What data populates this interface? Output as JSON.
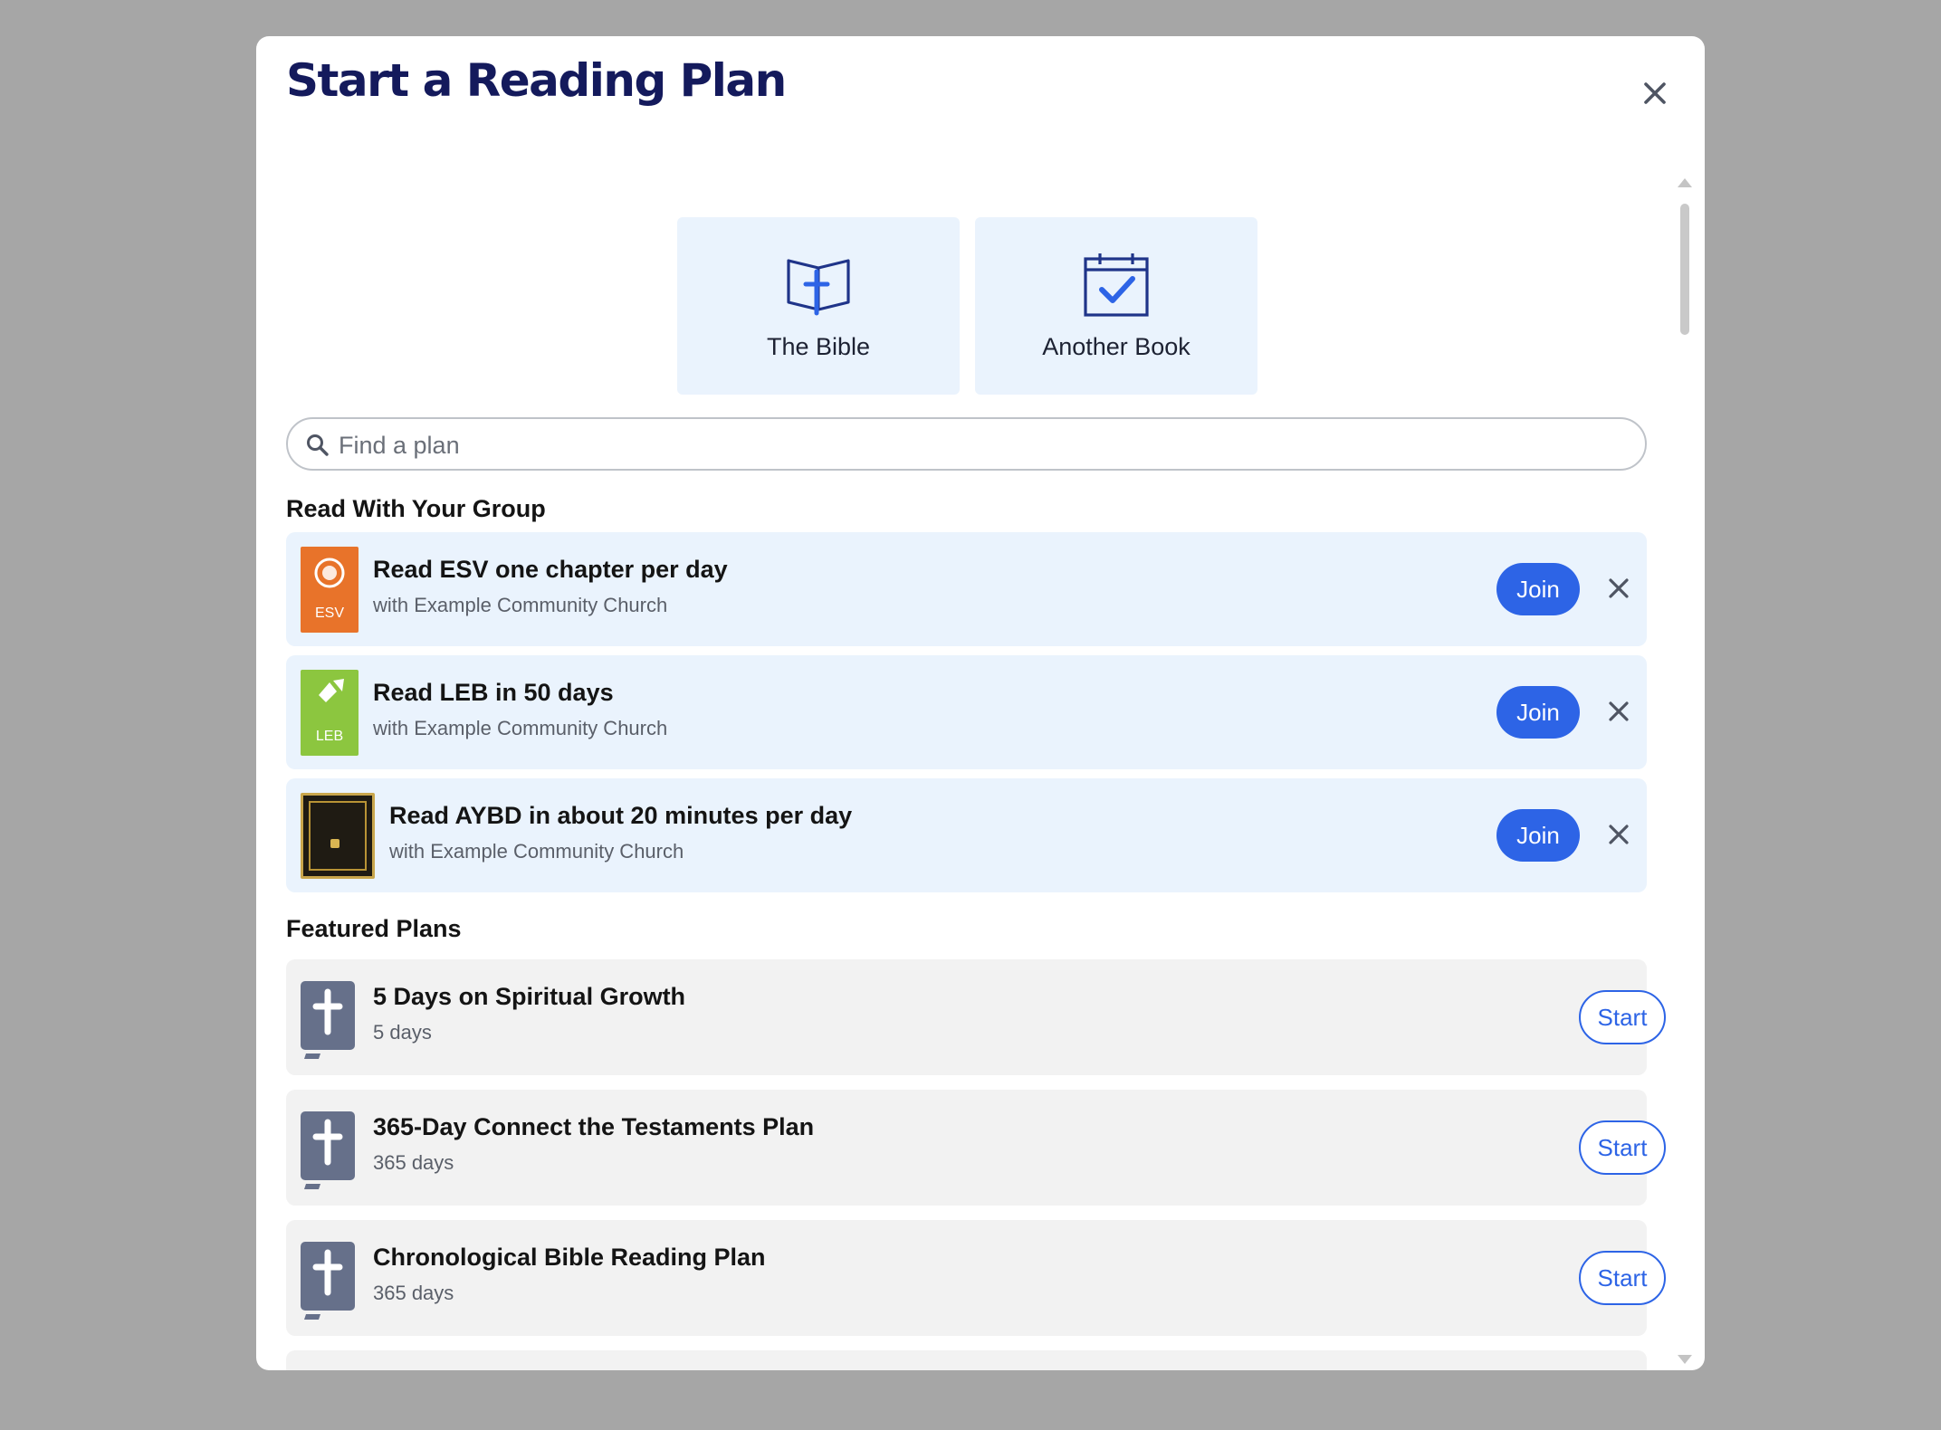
{
  "modal": {
    "title": "Start a Reading Plan",
    "close_icon": "close-icon"
  },
  "choices": [
    {
      "label": "The Bible",
      "icon": "bible-icon"
    },
    {
      "label": "Another Book",
      "icon": "calendar-check-icon"
    }
  ],
  "search": {
    "placeholder": "Find a plan",
    "value": "",
    "icon": "search-icon"
  },
  "group_section": {
    "title": "Read With Your Group",
    "plans": [
      {
        "title": "Read ESV one chapter per day",
        "subtitle": "with Example Community Church",
        "cover_tag": "ESV",
        "action": "Join"
      },
      {
        "title": "Read LEB in 50 days",
        "subtitle": "with Example Community Church",
        "cover_tag": "LEB",
        "action": "Join"
      },
      {
        "title": "Read AYBD in about 20 minutes per day",
        "subtitle": "with Example Community Church",
        "cover_tag": "",
        "action": "Join"
      }
    ]
  },
  "featured_section": {
    "title": "Featured Plans",
    "plans": [
      {
        "title": "5 Days on Spiritual Growth",
        "duration": "5 days",
        "action": "Start"
      },
      {
        "title": "365-Day Connect the Testaments Plan",
        "duration": "365 days",
        "action": "Start"
      },
      {
        "title": "Chronological Bible Reading Plan",
        "duration": "365 days",
        "action": "Start"
      }
    ]
  },
  "colors": {
    "title": "#141a5c",
    "accent": "#2d64e6",
    "group_card_bg": "#eaf3fd",
    "plan_card_bg": "#f2f2f2",
    "esv_cover": "#e8732a",
    "leb_cover": "#8cc63f"
  }
}
